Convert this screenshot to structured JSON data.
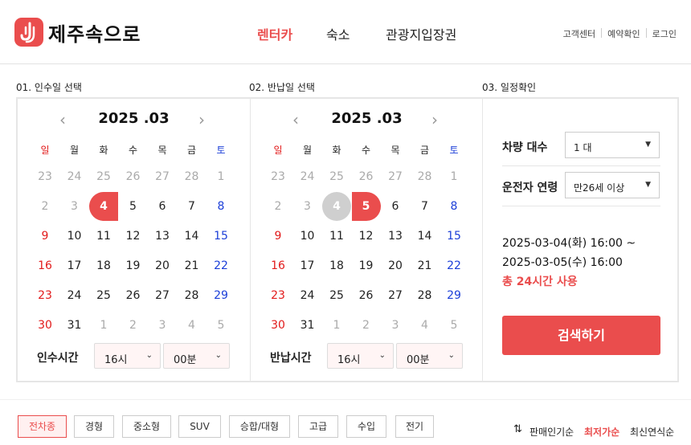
{
  "brand": {
    "name": "제주속으로",
    "accent": "#ea4d4d",
    "logo_icon": "j-pin-logo-icon"
  },
  "nav": [
    {
      "label": "렌터카",
      "active": true
    },
    {
      "label": "숙소",
      "active": false
    },
    {
      "label": "관광지입장권",
      "active": false
    }
  ],
  "util": [
    "고객센터",
    "예약확인",
    "로그인"
  ],
  "sections": {
    "pickup": "01. 인수일 선택",
    "return": "02. 반납일 선택",
    "confirm": "03. 일정확인"
  },
  "weekdays": [
    "일",
    "월",
    "화",
    "수",
    "목",
    "금",
    "토"
  ],
  "calendars": [
    {
      "title": "2025 .03",
      "time_label": "인수시간",
      "hour": "16시",
      "minute": "00분",
      "weeks": [
        [
          {
            "d": "23",
            "o": 1
          },
          {
            "d": "24",
            "o": 1
          },
          {
            "d": "25",
            "o": 1
          },
          {
            "d": "26",
            "o": 1
          },
          {
            "d": "27",
            "o": 1
          },
          {
            "d": "28",
            "o": 1
          },
          {
            "d": "1",
            "o": 1
          }
        ],
        [
          {
            "d": "2",
            "o": 1
          },
          {
            "d": "3",
            "o": 1
          },
          {
            "d": "4",
            "s": "selL"
          },
          {
            "d": "5"
          },
          {
            "d": "6"
          },
          {
            "d": "7"
          },
          {
            "d": "8"
          }
        ],
        [
          {
            "d": "9"
          },
          {
            "d": "10"
          },
          {
            "d": "11"
          },
          {
            "d": "12"
          },
          {
            "d": "13"
          },
          {
            "d": "14"
          },
          {
            "d": "15"
          }
        ],
        [
          {
            "d": "16"
          },
          {
            "d": "17"
          },
          {
            "d": "18"
          },
          {
            "d": "19"
          },
          {
            "d": "20"
          },
          {
            "d": "21"
          },
          {
            "d": "22"
          }
        ],
        [
          {
            "d": "23"
          },
          {
            "d": "24"
          },
          {
            "d": "25"
          },
          {
            "d": "26"
          },
          {
            "d": "27"
          },
          {
            "d": "28"
          },
          {
            "d": "29"
          }
        ],
        [
          {
            "d": "30"
          },
          {
            "d": "31"
          },
          {
            "d": "1",
            "o": 1
          },
          {
            "d": "2",
            "o": 1
          },
          {
            "d": "3",
            "o": 1
          },
          {
            "d": "4",
            "o": 1
          },
          {
            "d": "5",
            "o": 1
          }
        ]
      ]
    },
    {
      "title": "2025 .03",
      "time_label": "반납시간",
      "hour": "16시",
      "minute": "00분",
      "weeks": [
        [
          {
            "d": "23",
            "o": 1
          },
          {
            "d": "24",
            "o": 1
          },
          {
            "d": "25",
            "o": 1
          },
          {
            "d": "26",
            "o": 1
          },
          {
            "d": "27",
            "o": 1
          },
          {
            "d": "28",
            "o": 1
          },
          {
            "d": "1",
            "o": 1
          }
        ],
        [
          {
            "d": "2",
            "o": 1
          },
          {
            "d": "3",
            "o": 1
          },
          {
            "d": "4",
            "s": "dis"
          },
          {
            "d": "5",
            "s": "selR"
          },
          {
            "d": "6"
          },
          {
            "d": "7"
          },
          {
            "d": "8"
          }
        ],
        [
          {
            "d": "9"
          },
          {
            "d": "10"
          },
          {
            "d": "11"
          },
          {
            "d": "12"
          },
          {
            "d": "13"
          },
          {
            "d": "14"
          },
          {
            "d": "15"
          }
        ],
        [
          {
            "d": "16"
          },
          {
            "d": "17"
          },
          {
            "d": "18"
          },
          {
            "d": "19"
          },
          {
            "d": "20"
          },
          {
            "d": "21"
          },
          {
            "d": "22"
          }
        ],
        [
          {
            "d": "23"
          },
          {
            "d": "24"
          },
          {
            "d": "25"
          },
          {
            "d": "26"
          },
          {
            "d": "27"
          },
          {
            "d": "28"
          },
          {
            "d": "29"
          }
        ],
        [
          {
            "d": "30"
          },
          {
            "d": "31"
          },
          {
            "d": "1",
            "o": 1
          },
          {
            "d": "2",
            "o": 1
          },
          {
            "d": "3",
            "o": 1
          },
          {
            "d": "4",
            "o": 1
          },
          {
            "d": "5",
            "o": 1
          }
        ]
      ]
    }
  ],
  "options": {
    "car_count_label": "차량 대수",
    "car_count_value": "1 대",
    "driver_age_label": "운전자 연령",
    "driver_age_value": "만26세 이상"
  },
  "summary": {
    "start": "2025-03-04(화) 16:00 ~",
    "end": "2025-03-05(수) 16:00",
    "total": "총 24시간 사용"
  },
  "search_label": "검색하기",
  "filters": [
    {
      "label": "전차종",
      "active": true
    },
    {
      "label": "경형"
    },
    {
      "label": "중소형"
    },
    {
      "label": "SUV"
    },
    {
      "label": "승합/대형"
    },
    {
      "label": "고급"
    },
    {
      "label": "수입"
    },
    {
      "label": "전기"
    }
  ],
  "sort": {
    "icon": "sort-arrows-icon",
    "items": [
      {
        "label": "판매인기순"
      },
      {
        "label": "최저가순",
        "active": true
      },
      {
        "label": "최신연식순"
      }
    ]
  }
}
